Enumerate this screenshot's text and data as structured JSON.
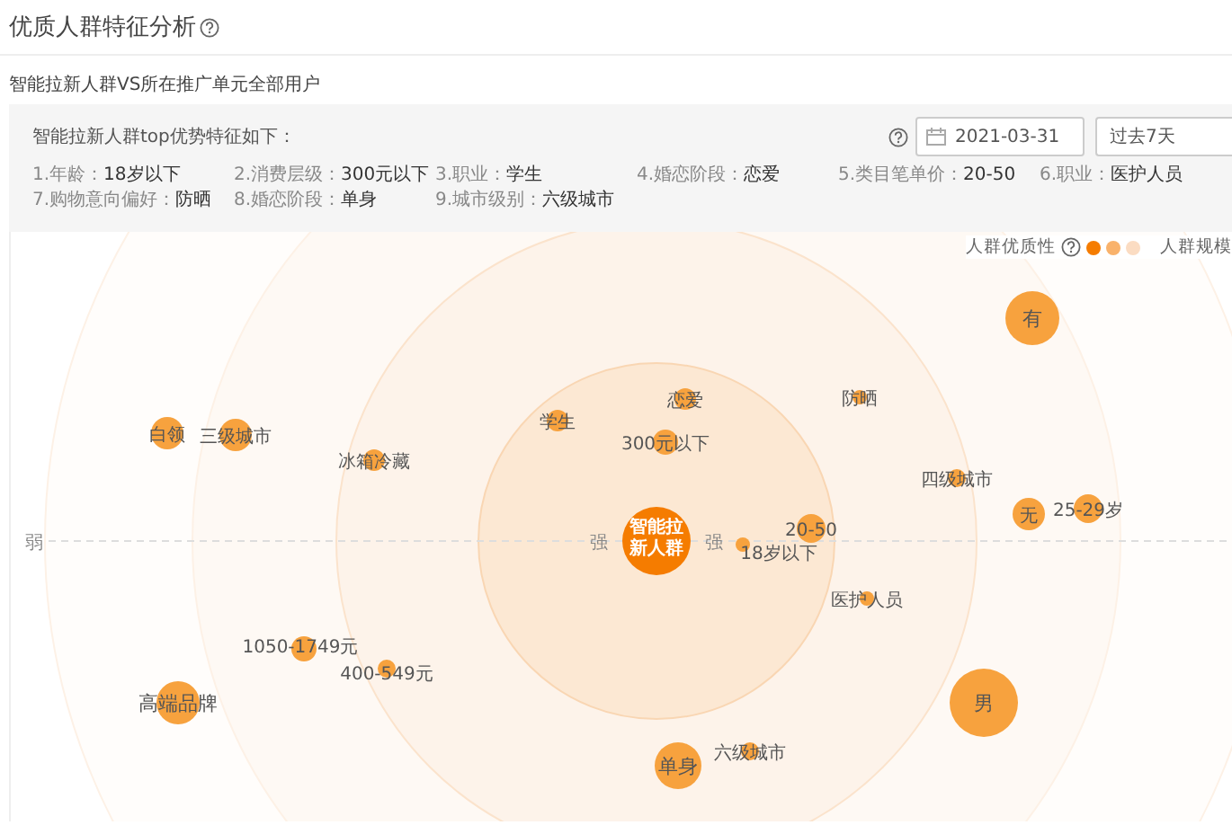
{
  "header": {
    "title": "优质人群特征分析"
  },
  "subtitle": "智能拉新人群VS所在推广单元全部用户",
  "panel": {
    "heading": "智能拉新人群top优势特征如下：",
    "date": "2021-03-31",
    "period": "过去7天",
    "features": [
      {
        "label": "1.年龄：",
        "value": "18岁以下"
      },
      {
        "label": "2.消费层级：",
        "value": "300元以下"
      },
      {
        "label": "3.职业：",
        "value": "学生"
      },
      {
        "label": "4.婚恋阶段：",
        "value": "恋爱"
      },
      {
        "label": "5.类目笔单价：",
        "value": "20-50"
      },
      {
        "label": "6.职业：",
        "value": "医护人员"
      },
      {
        "label": "7.购物意向偏好：",
        "value": "防晒"
      },
      {
        "label": "8.婚恋阶段：",
        "value": "单身"
      },
      {
        "label": "9.城市级别：",
        "value": "六级城市"
      }
    ]
  },
  "chart": {
    "legend": {
      "quality_label": "人群优质性",
      "dots": [
        {
          "color": "#f57c00"
        },
        {
          "color": "#f9b26b"
        },
        {
          "color": "#fbdcc2"
        }
      ],
      "size_label": "人群规模"
    },
    "axis_labels": [
      "弱",
      "强",
      "强"
    ],
    "center": "智能拉新人群",
    "bubbles": [
      {
        "label": "白领"
      },
      {
        "label": "三级城市"
      },
      {
        "label": "冰箱冷藏"
      },
      {
        "label": "学生"
      },
      {
        "label": "恋爱"
      },
      {
        "label": "300元以下"
      },
      {
        "label": "防晒"
      },
      {
        "label": "有"
      },
      {
        "label": "四级城市"
      },
      {
        "label": "无"
      },
      {
        "label": "25-29岁"
      },
      {
        "label": "20-50"
      },
      {
        "label": "18岁以下"
      },
      {
        "label": "医护人员"
      },
      {
        "label": "男"
      },
      {
        "label": "单身"
      },
      {
        "label": "六级城市"
      },
      {
        "label": "1050-1749元"
      },
      {
        "label": "400-549元"
      },
      {
        "label": "高端品牌"
      }
    ]
  }
}
